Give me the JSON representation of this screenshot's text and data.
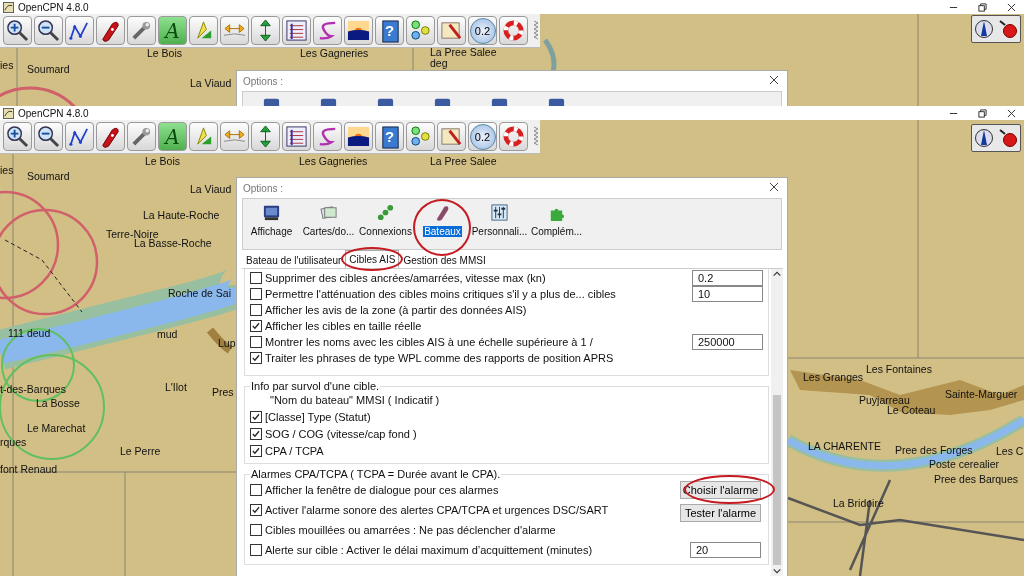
{
  "top_capture": {
    "window": {
      "title": "OpenCPN 4.8.0"
    },
    "toolbar": {
      "text_tool_letter": "A",
      "help_glyph": "?",
      "scale_value": "0.2"
    },
    "map_labels": [
      "ies",
      "Soumard",
      "Le Bois",
      "La Viaud",
      "Les Gagneries",
      "La Pree Salee",
      "deg"
    ],
    "options_dialog": {
      "title": "Options :"
    }
  },
  "bottom_capture": {
    "window": {
      "title": "OpenCPN 4.8.0"
    },
    "toolbar": {
      "text_tool_letter": "A",
      "help_glyph": "?",
      "scale_value": "0.2"
    },
    "map_labels": [
      "Le Bois",
      "ies",
      "Soumard",
      "La Viaud",
      "Les Gagneries",
      "La Pree Salee",
      "La Haute-Roche",
      "Terre-Noire",
      "La Basse-Roche",
      "Roche de Sai",
      "111 deud",
      "mud",
      "Lup",
      "t-des-Barques",
      "L'Ilot",
      "Pres",
      "La Bosse",
      "Le Marechat",
      "rques",
      "Le Perre",
      "font Renaud",
      "Les Granges",
      "Les Fontaines",
      "Puyjarreau",
      "Le Coteau",
      "Sainte-Marguer",
      "LA CHARENTE",
      "Pree des Forges",
      "Poste cerealier",
      "Les C",
      "Pree des Barques",
      "La Bridoire"
    ],
    "options_dialog": {
      "title": "Options :",
      "categories": [
        {
          "label": "Affichage",
          "selected": false
        },
        {
          "label": "Cartes/do...",
          "selected": false
        },
        {
          "label": "Connexions",
          "selected": false
        },
        {
          "label": "Bateaux",
          "selected": true
        },
        {
          "label": "Personnali...",
          "selected": false
        },
        {
          "label": "Complém...",
          "selected": false
        }
      ],
      "tabs": [
        {
          "label": "Bateau de l'utilisateur",
          "selected": false
        },
        {
          "label": "Cibles AIS",
          "selected": true
        },
        {
          "label": "Gestion des MMSI",
          "selected": false
        }
      ],
      "ais_rows": [
        {
          "label": "Supprimer des cibles ancrées/amarrées, vitesse max (kn)",
          "checked": false,
          "value": "0.2"
        },
        {
          "label": "Permettre l'atténuation des cibles moins critiques s'il y a plus de... cibles",
          "checked": false,
          "value": "10"
        },
        {
          "label": "Afficher les avis de la zone (à partir des données AIS)",
          "checked": false
        },
        {
          "label": "Afficher les cibles en taille réelle",
          "checked": true
        },
        {
          "label": "Montrer les noms avec les cibles AIS à une échelle supérieure à 1 /",
          "checked": false,
          "value": "250000"
        },
        {
          "label": "Traiter les phrases de type WPL comme des rapports de position APRS",
          "checked": true
        }
      ],
      "hover_info": {
        "title": "Info par survol d'une cible.",
        "caption": "\"Nom du bateau\"  MMSI  ( Indicatif )",
        "items": [
          {
            "label": "[Classe] Type (Statut)",
            "checked": true
          },
          {
            "label": "SOG / COG  (vitesse/cap fond )",
            "checked": true
          },
          {
            "label": "CPA / TCPA",
            "checked": true
          }
        ]
      },
      "alarms": {
        "title": "Alarmes CPA/TCPA ( TCPA = Durée avant le CPA).",
        "rows": [
          {
            "label": "Afficher la fenêtre de dialogue pour ces alarmes",
            "checked": false,
            "button": "Choisir l'alarme"
          },
          {
            "label": "Activer l'alarme sonore des alertes CPA/TCPA et urgences DSC/SART",
            "checked": true,
            "button": "Tester l'alarme"
          },
          {
            "label": "Cibles mouillées ou amarrées : Ne pas déclencher d'alarme",
            "checked": false
          },
          {
            "label": "Alerte sur cible : Activer le délai maximum d’acquittement (minutes)",
            "checked": false,
            "value": "20"
          }
        ]
      }
    }
  }
}
